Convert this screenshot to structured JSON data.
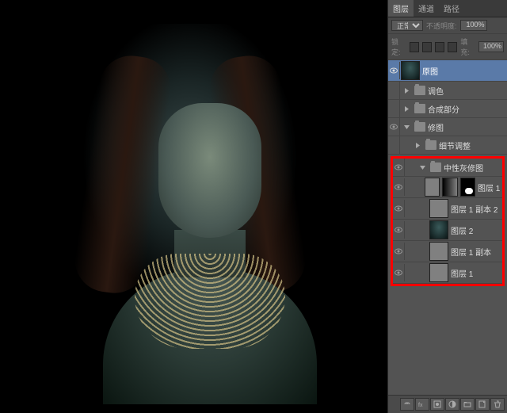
{
  "tabs": {
    "layers": "图层",
    "channels": "通道",
    "paths": "路径"
  },
  "opts": {
    "blend": "正常",
    "opacity_label": "不透明度:",
    "opacity": "100%",
    "lock_label": "锁定:",
    "fill_label": "填充:",
    "fill": "100%"
  },
  "layers": {
    "l0": "原图",
    "g1": "调色",
    "g2": "合成部分",
    "g3": "修图",
    "g3a": "细节调整",
    "g4": "中性灰修图",
    "r1": "图层 1...",
    "r2": "图层 1 副本 2",
    "r3": "图层 2",
    "r4": "图层 1 副本",
    "r5": "图层 1"
  },
  "icons": {
    "eye": "eye-icon",
    "tri_open": "triangle-down",
    "tri_closed": "triangle-right",
    "fx": "fx",
    "link": "link",
    "mask": "mask",
    "adj": "adjustment",
    "folder": "new-folder",
    "new": "new-layer",
    "trash": "trash"
  }
}
